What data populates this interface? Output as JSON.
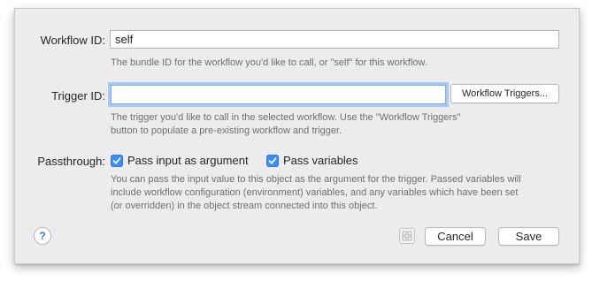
{
  "workflow_id": {
    "label": "Workflow ID:",
    "value": "self",
    "help": "The bundle ID for the workflow you'd like to call, or \"self\" for this workflow."
  },
  "trigger_id": {
    "label": "Trigger ID:",
    "value": "",
    "button_label": "Workflow Triggers...",
    "help_line1": "The trigger you'd like to call in the selected workflow. Use the \"Workflow Triggers\"",
    "help_line2": "button to populate a pre-existing workflow and trigger."
  },
  "passthrough": {
    "label": "Passthrough:",
    "options": [
      {
        "label": "Pass input as argument",
        "checked": true
      },
      {
        "label": "Pass variables",
        "checked": true
      }
    ],
    "help_line1": "You can pass the input value to this object as the argument for the trigger. Passed variables will",
    "help_line2": "include workflow configuration (environment) variables, and any variables which have been set",
    "help_line3": "(or overridden) in the object stream connected into this object."
  },
  "footer": {
    "help_icon_glyph": "?",
    "cancel_label": "Cancel",
    "save_label": "Save"
  },
  "icons": [
    "help-icon",
    "grid-icon",
    "checkmark-icon"
  ],
  "colors": {
    "accent": "#3a8ef5",
    "focus_ring": "#a9c9f3",
    "sheet_bg": "#ececec"
  }
}
